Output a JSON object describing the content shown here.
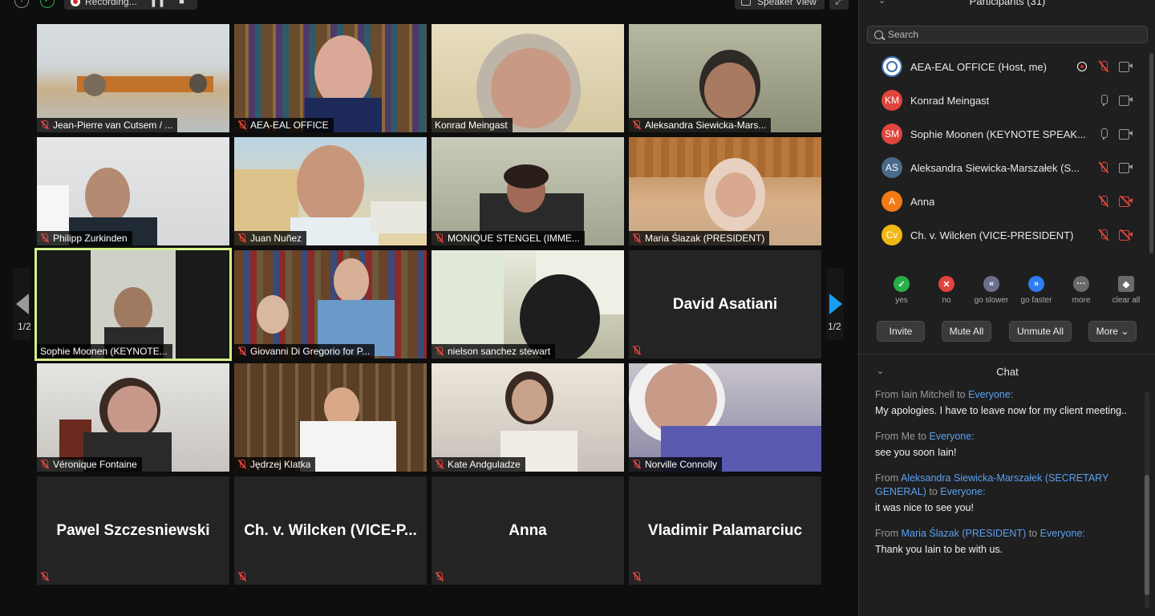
{
  "topbar": {
    "recording_label": "Recording...",
    "view_label": "Speaker View"
  },
  "pager": {
    "left": "1/2",
    "right": "1/2"
  },
  "tiles": [
    {
      "name": "Jean-Pierre van Cutsem / ...",
      "muted": true
    },
    {
      "name": "AEA-EAL OFFICE",
      "muted": true
    },
    {
      "name": "Konrad Meingast",
      "muted": false
    },
    {
      "name": "Aleksandra Siewicka-Mars...",
      "muted": true
    },
    {
      "name": "Philipp Zurkinden",
      "muted": true
    },
    {
      "name": "Juan Nuñez",
      "muted": true
    },
    {
      "name": "MONIQUE STENGEL (IMME...",
      "muted": true
    },
    {
      "name": "Maria Ślazak (PRESIDENT)",
      "muted": true
    },
    {
      "name": "Sophie Moonen (KEYNOTE...",
      "muted": false,
      "active": true
    },
    {
      "name": "Giovanni Di Gregorio for P...",
      "muted": true
    },
    {
      "name": "nielson sanchez stewart",
      "muted": true
    },
    {
      "name": "David Asatiani",
      "muted": true,
      "no_video": true
    },
    {
      "name": "Véronique Fontaine",
      "muted": true
    },
    {
      "name": "Jędrzej Klatka",
      "muted": true
    },
    {
      "name": "Kate Andguladze",
      "muted": true
    },
    {
      "name": "Norville Connolly",
      "muted": true
    },
    {
      "name": "Pawel Szczesniewski",
      "muted": true,
      "no_video": true
    },
    {
      "name": "Ch. v. Wilcken (VICE-P...",
      "muted": true,
      "no_video": true
    },
    {
      "name": "Anna",
      "muted": true,
      "no_video": true
    },
    {
      "name": "Vladimir Palamarciuc",
      "muted": true,
      "no_video": true
    }
  ],
  "participants": {
    "title": "Participants (31)",
    "search_placeholder": "Search",
    "list": [
      {
        "initials": "",
        "name": "AEA-EAL OFFICE (Host, me)",
        "color": "#ffffff",
        "mic": "off",
        "cam": "on",
        "recording": true
      },
      {
        "initials": "KM",
        "name": "Konrad Meingast",
        "color": "#e0443c",
        "mic": "on",
        "cam": "on"
      },
      {
        "initials": "SM",
        "name": "Sophie Moonen (KEYNOTE SPEAK...",
        "color": "#e0443c",
        "mic": "on",
        "cam": "on"
      },
      {
        "initials": "AS",
        "name": "Aleksandra Siewicka-Marszałek (S...",
        "color": "#4a6a8c",
        "mic": "off",
        "cam": "on"
      },
      {
        "initials": "A",
        "name": "Anna",
        "color": "#f07a14",
        "mic": "off",
        "cam": "off"
      },
      {
        "initials": "Cv",
        "name": "Ch. v. Wilcken (VICE-PRESIDENT)",
        "color": "#f0b814",
        "mic": "off",
        "cam": "off"
      }
    ],
    "nonverbal": [
      {
        "label": "yes",
        "color": "#27b04a",
        "glyph": "✓",
        "icon": "check-icon"
      },
      {
        "label": "no",
        "color": "#e0443c",
        "glyph": "✕",
        "icon": "x-icon"
      },
      {
        "label": "go slower",
        "color": "#6b6f8c",
        "glyph": "«",
        "icon": "rewind-icon"
      },
      {
        "label": "go faster",
        "color": "#2d7cf0",
        "glyph": "»",
        "icon": "fast-forward-icon"
      },
      {
        "label": "more",
        "color": "#6a6a6a",
        "glyph": "···",
        "icon": "ellipsis-icon"
      },
      {
        "label": "clear all",
        "color": "#555555",
        "glyph": "◆",
        "icon": "eraser-icon"
      }
    ],
    "buttons": {
      "invite": "Invite",
      "mute_all": "Mute All",
      "unmute_all": "Unmute All",
      "more": "More"
    }
  },
  "chat": {
    "title": "Chat",
    "messages": [
      {
        "from_prefix": "From ",
        "from": "Iain Mitchell",
        "to_prefix": " to ",
        "to": "Everyone",
        "suffix": ":",
        "text": "My apologies. I have to leave now for my client meeting..",
        "from_hl": false
      },
      {
        "from_prefix": "From ",
        "from": "Me",
        "to_prefix": " to ",
        "to": "Everyone",
        "suffix": ":",
        "text": "see you soon Iain!",
        "from_hl": false
      },
      {
        "from_prefix": "From ",
        "from": "Aleksandra Siewicka-Marszałek (SECRETARY GENERAL)",
        "to_prefix": " to ",
        "to": "Everyone",
        "suffix": ":",
        "text": "it was nice to see you!",
        "from_hl": true
      },
      {
        "from_prefix": "From ",
        "from": "Maria Ślazak (PRESIDENT)",
        "to_prefix": " to ",
        "to": "Everyone",
        "suffix": ":",
        "text": "Thank you Iain to be with us.",
        "from_hl": true
      }
    ]
  }
}
